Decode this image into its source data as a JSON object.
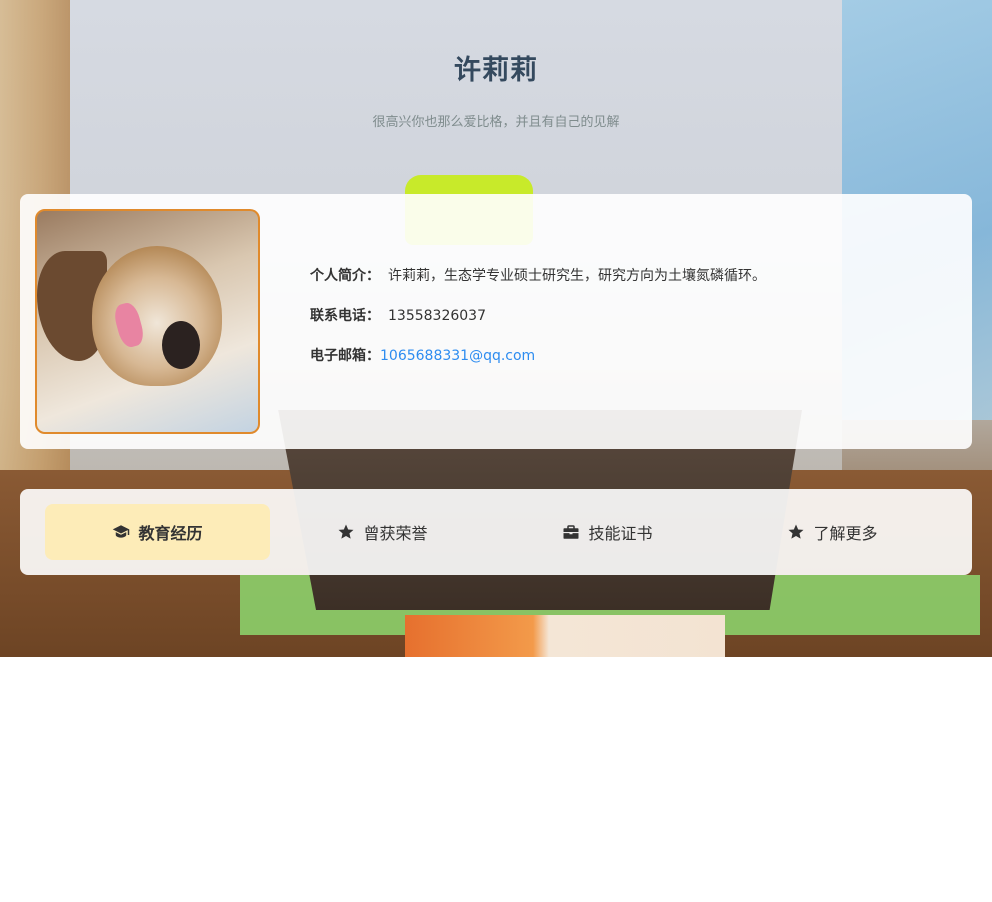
{
  "header": {
    "title": "许莉莉",
    "subtitle": "很高兴你也那么爱比格，并且有自己的见解"
  },
  "profile": {
    "bio_label": "个人简介：",
    "bio_value": "许莉莉，生态学专业硕士研究生，研究方向为土壤氮磷循环。",
    "phone_label": "联系电话：",
    "phone_value": "13558326037",
    "email_label": "电子邮箱：",
    "email_value": "1065688331@qq.com"
  },
  "tabs": [
    {
      "label": "教育经历",
      "icon": "graduation-cap-icon",
      "active": true
    },
    {
      "label": "曾获荣誉",
      "icon": "star-icon",
      "active": false
    },
    {
      "label": "技能证书",
      "icon": "briefcase-icon",
      "active": false
    },
    {
      "label": "了解更多",
      "icon": "star-icon",
      "active": false
    }
  ],
  "colors": {
    "title": "#34495e",
    "subtitle": "#7f8c8d",
    "link": "#2d8cf0",
    "active_tab": "#fdecb8",
    "avatar_border": "#e08a2c"
  }
}
